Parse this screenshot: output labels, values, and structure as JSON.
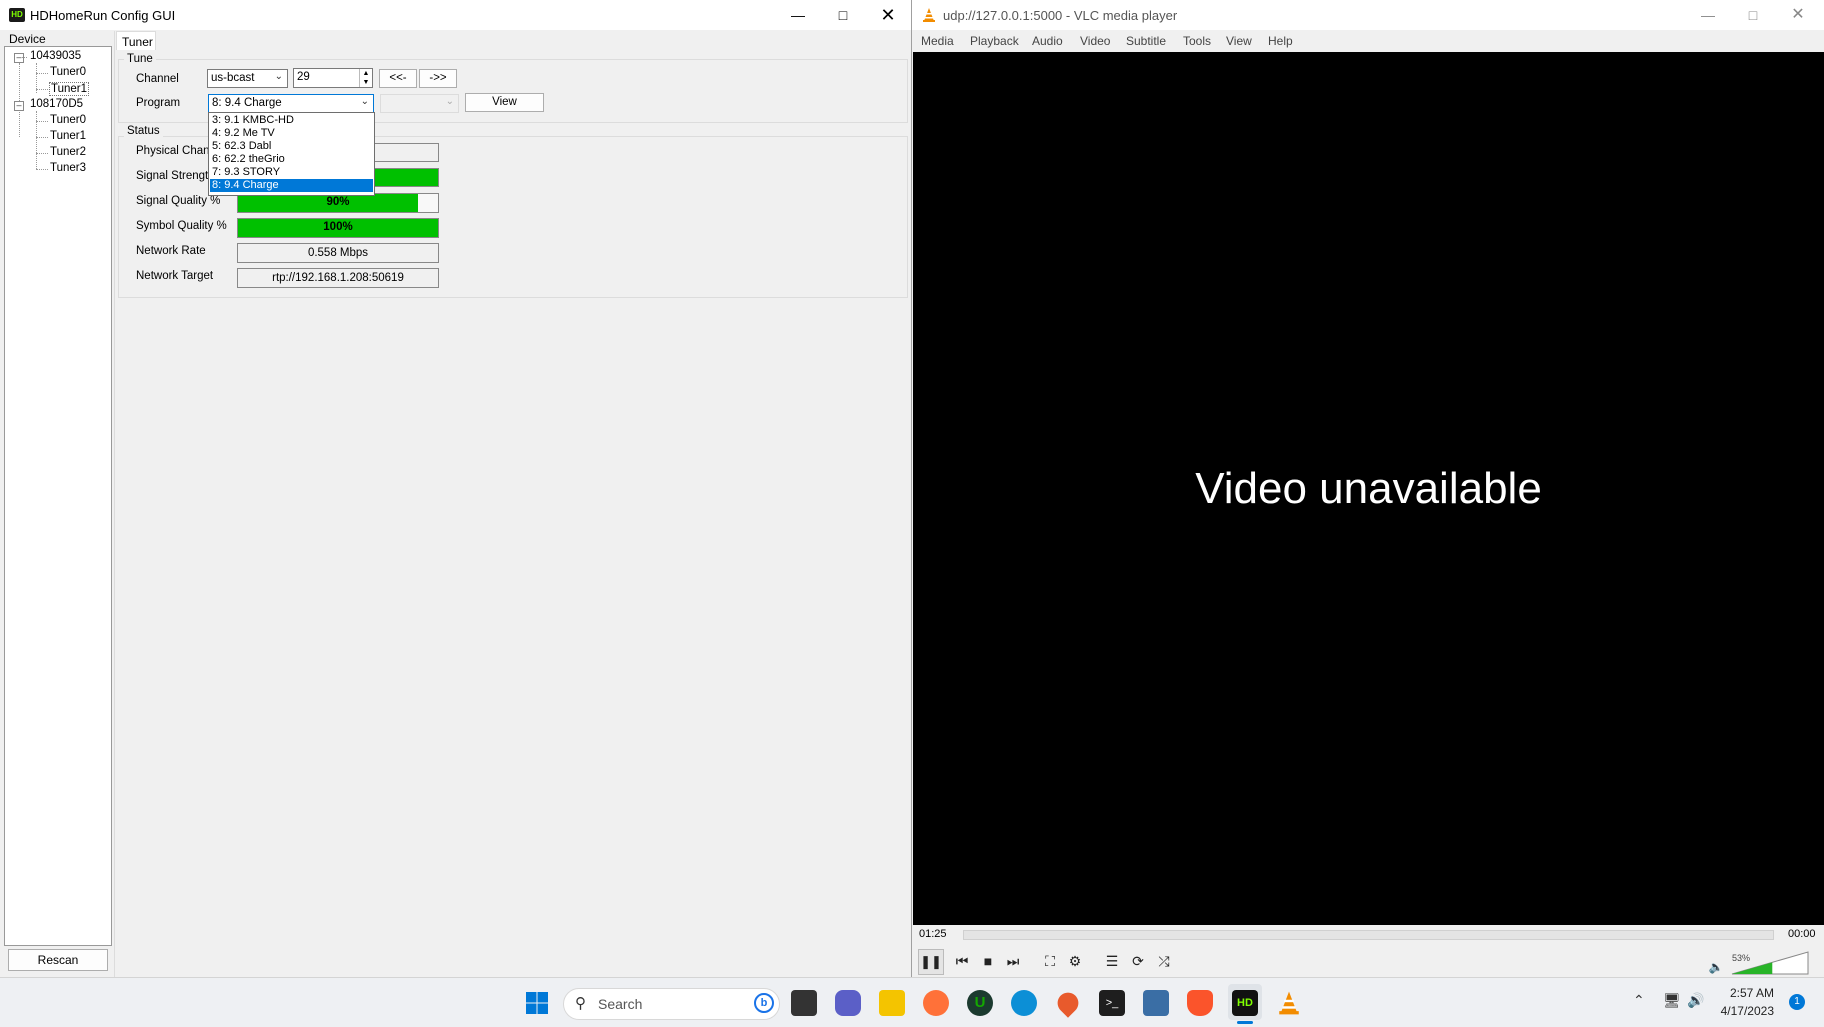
{
  "hdhomerun": {
    "title": "HDHomeRun Config GUI",
    "logo_text": "HD",
    "device_tab": "Device",
    "tuner_tab": "Tuner",
    "devices": [
      {
        "id": "10439035",
        "tuners": [
          "Tuner0",
          "Tuner1"
        ]
      },
      {
        "id": "108170D5",
        "tuners": [
          "Tuner0",
          "Tuner1",
          "Tuner2",
          "Tuner3"
        ]
      }
    ],
    "rescan_label": "Rescan",
    "tune_group": "Tune",
    "channel_label": "Channel",
    "channel_map": "us-bcast",
    "channel_number": "29",
    "prev_label": "<<-",
    "next_label": "->>",
    "program_label": "Program",
    "program_selected": "8: 9.4 Charge",
    "view_label": "View",
    "program_options": [
      "3: 9.1 KMBC-HD",
      "4: 9.2 Me TV",
      "5: 62.3 Dabl",
      "6: 62.2 theGrio",
      "7: 9.3 STORY",
      "8: 9.4 Charge"
    ],
    "status_group": "Status",
    "physical_channel_label": "Physical Chann",
    "signal_strength_label": "Signal Strength",
    "signal_quality_label": "Signal Quality %",
    "signal_quality_value": "90%",
    "signal_quality_fraction": 0.9,
    "symbol_quality_label": "Symbol Quality %",
    "symbol_quality_value": "100%",
    "symbol_quality_fraction": 1.0,
    "network_rate_label": "Network Rate",
    "network_rate_value": "0.558 Mbps",
    "network_target_label": "Network Target",
    "network_target_value": "rtp://192.168.1.208:50619"
  },
  "vlc": {
    "title": "udp://127.0.0.1:5000 - VLC media player",
    "menu": [
      "Media",
      "Playback",
      "Audio",
      "Video",
      "Subtitle",
      "Tools",
      "View",
      "Help"
    ],
    "video_message": "Video unavailable",
    "elapsed": "01:25",
    "total": "00:00",
    "volume": "53%",
    "volume_fraction": 0.53
  },
  "taskbar": {
    "search_placeholder": "Search",
    "time": "2:57 AM",
    "date": "4/17/2023",
    "notification_count": "1",
    "app_icons": [
      "file-explorer-icon",
      "teams-icon",
      "folder-icon",
      "firefox-icon",
      "upwork-icon",
      "edge-icon",
      "maps-pin-icon",
      "terminal-icon",
      "task-manager-icon",
      "brave-icon",
      "hdhomerun-icon",
      "vlc-icon"
    ],
    "accent": "#0078d7"
  }
}
